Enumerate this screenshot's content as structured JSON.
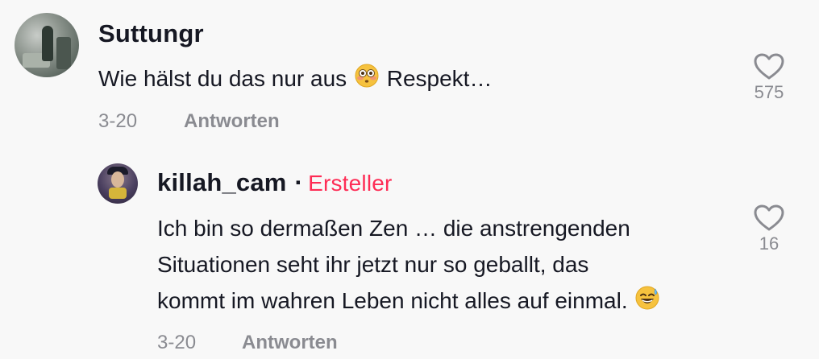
{
  "comments": [
    {
      "username": "Suttungr",
      "text_before_emoji": "Wie hälst du das nur aus",
      "text_after_emoji": "Respekt…",
      "emoji": "flushed-face",
      "date": "3-20",
      "reply_label": "Antworten",
      "likes": "575"
    }
  ],
  "reply": {
    "username": "killah_cam",
    "separator": "·",
    "badge": "Ersteller",
    "line1": "Ich bin so dermaßen Zen … die anstrengenden",
    "line2": "Situationen seht ihr jetzt nur so geballt, das",
    "line3": "kommt im wahren Leben nicht alles auf einmal.",
    "emoji": "grinning-face-with-sweat",
    "date": "3-20",
    "reply_label": "Antworten",
    "likes": "16"
  },
  "colors": {
    "background": "#f8f8f8",
    "text": "#161823",
    "muted": "#8a8b91",
    "creator_badge": "#fe2c55"
  }
}
